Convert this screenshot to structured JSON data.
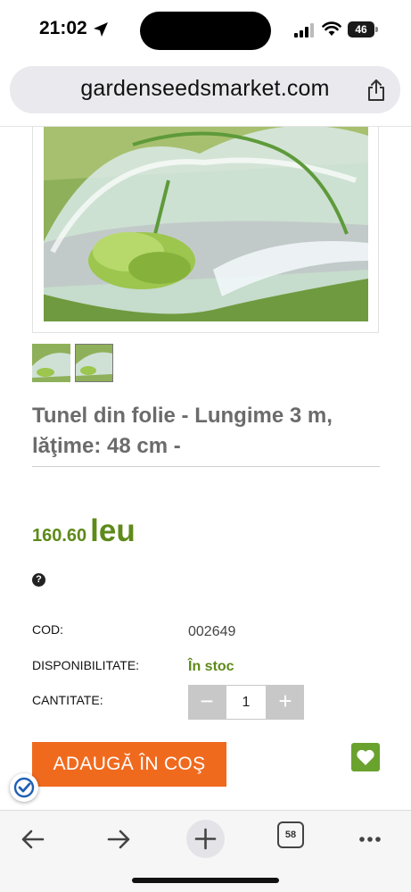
{
  "status_bar": {
    "time": "21:02",
    "battery": "46",
    "icons": [
      "location-arrow-icon",
      "cell-signal-icon",
      "wifi-icon",
      "battery-icon"
    ]
  },
  "browser": {
    "url": "gardenseedsmarket.com",
    "share_icon": "share-icon",
    "tab_count": "58",
    "toolbar_icons": [
      "back-arrow-icon",
      "forward-arrow-icon",
      "plus-icon",
      "tabs-icon",
      "more-icon"
    ]
  },
  "product": {
    "title": "Tunel din folie - Lungime 3 m, lăţime: 48 cm -",
    "price_number": "160.60",
    "price_currency": "leu",
    "help_icon": "?",
    "specs": {
      "cod_label": "COD:",
      "cod_value": "002649",
      "availability_label": "DISPONIBILITATE:",
      "availability_value": "În stoc",
      "quantity_label": "CANTITATE:"
    },
    "quantity": {
      "minus": "−",
      "value": "1",
      "plus": "+"
    },
    "add_to_cart": "ADAUGĂ ÎN COŞ"
  },
  "colors": {
    "price_green": "#5e8a1a",
    "cart_orange": "#f06a1e",
    "wishlist_green": "#6aa22e",
    "stepper_grey": "#c8c8c8"
  }
}
